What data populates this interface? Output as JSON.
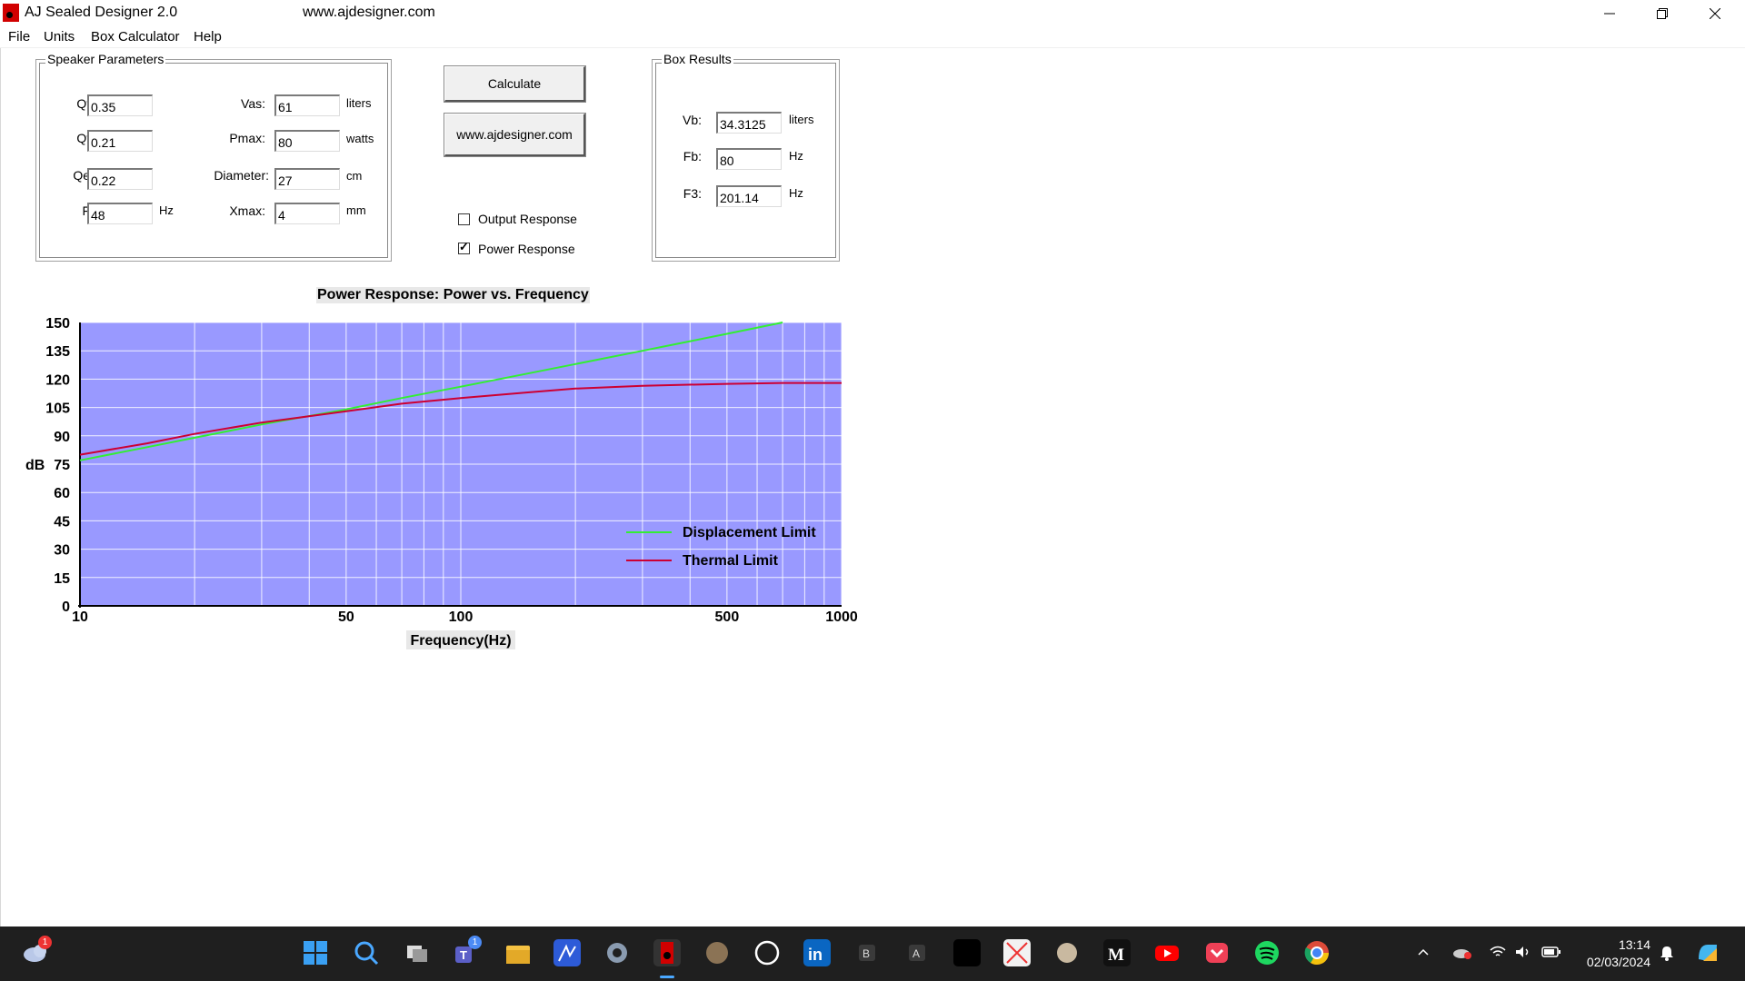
{
  "window": {
    "title": "AJ Sealed Designer 2.0",
    "url": "www.ajdesigner.com"
  },
  "menu": [
    "File",
    "Units",
    "Box Calculator",
    "Help"
  ],
  "speaker_parameters": {
    "title": "Speaker Parameters",
    "qtc": {
      "label": "Qtc:",
      "value": "0.35"
    },
    "qts": {
      "label": "Qts:",
      "value": "0.21"
    },
    "qes": {
      "label": "Qes:",
      "value": "0.22"
    },
    "fs": {
      "label": "Fs:",
      "value": "48",
      "unit": "Hz"
    },
    "vas": {
      "label": "Vas:",
      "value": "61",
      "unit": "liters"
    },
    "pmax": {
      "label": "Pmax:",
      "value": "80",
      "unit": "watts"
    },
    "diameter": {
      "label": "Diameter:",
      "value": "27",
      "unit": "cm"
    },
    "xmax": {
      "label": "Xmax:",
      "value": "4",
      "unit": "mm"
    }
  },
  "buttons": {
    "calculate": "Calculate",
    "website": "www.ajdesigner.com"
  },
  "options": {
    "output_response": {
      "label": "Output Response",
      "checked": false
    },
    "power_response": {
      "label": "Power Response",
      "checked": true
    }
  },
  "box_results": {
    "title": "Box Results",
    "vb": {
      "label": "Vb:",
      "value": "34.3125",
      "unit": "liters"
    },
    "fb": {
      "label": "Fb:",
      "value": "80",
      "unit": "Hz"
    },
    "f3": {
      "label": "F3:",
      "value": "201.14",
      "unit": "Hz"
    }
  },
  "chart_data": {
    "type": "line",
    "title": "Power Response: Power vs. Frequency",
    "xlabel": "Frequency(Hz)",
    "ylabel": "dB",
    "xscale": "log",
    "xlim": [
      10,
      1000
    ],
    "ylim": [
      0,
      150
    ],
    "xticks": [
      10,
      50,
      100,
      500,
      1000
    ],
    "yticks": [
      0,
      15,
      30,
      45,
      60,
      75,
      90,
      105,
      120,
      135,
      150
    ],
    "grid": true,
    "legend": "bottom-right",
    "plot_bg": "#9999ff",
    "series": [
      {
        "name": "Displacement Limit",
        "color": "#33ee33",
        "points": [
          [
            10,
            77
          ],
          [
            15,
            84
          ],
          [
            20,
            89
          ],
          [
            30,
            96
          ],
          [
            50,
            104
          ],
          [
            70,
            110
          ],
          [
            100,
            116
          ],
          [
            150,
            123
          ],
          [
            200,
            128
          ],
          [
            300,
            135
          ],
          [
            500,
            144
          ],
          [
            700,
            150
          ]
        ]
      },
      {
        "name": "Thermal Limit",
        "color": "#cc0033",
        "points": [
          [
            10,
            80
          ],
          [
            15,
            86
          ],
          [
            20,
            91
          ],
          [
            30,
            97
          ],
          [
            50,
            103
          ],
          [
            70,
            107
          ],
          [
            100,
            110
          ],
          [
            150,
            113
          ],
          [
            200,
            115
          ],
          [
            300,
            116.5
          ],
          [
            500,
            117.5
          ],
          [
            700,
            118
          ],
          [
            1000,
            118
          ]
        ]
      }
    ]
  },
  "taskbar": {
    "time": "13:14",
    "date": "02/03/2024",
    "weather_badge": "1",
    "teams_badge": "1"
  }
}
